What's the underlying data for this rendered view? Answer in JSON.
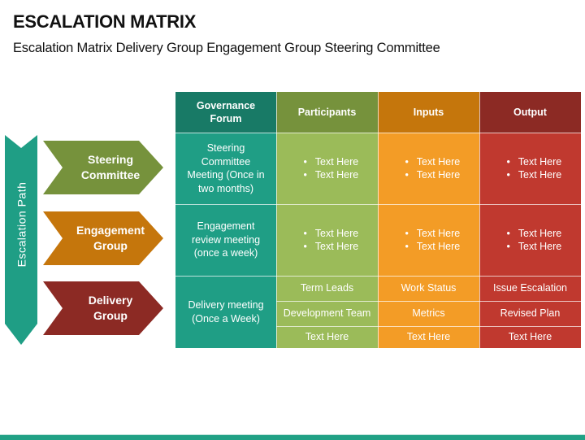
{
  "title": "ESCALATION MATRIX",
  "subtitle": "Escalation Matrix Delivery Group Engagement Group Steering Committee",
  "colors": {
    "teal": "#1f9e85",
    "teal_dark": "#187a66",
    "green": "#9bbb59",
    "green_dark": "#76923c",
    "orange": "#f39c26",
    "orange_dark": "#c5760c",
    "red": "#c0392f",
    "red_dark": "#8c2a24"
  },
  "escalation_path": {
    "label": "Escalation Path",
    "levels": [
      {
        "label_line1": "Steering",
        "label_line2": "Committee"
      },
      {
        "label_line1": "Engagement",
        "label_line2": "Group"
      },
      {
        "label_line1": "Delivery",
        "label_line2": "Group"
      }
    ]
  },
  "matrix": {
    "headers": {
      "governance_line1": "Governance",
      "governance_line2": "Forum",
      "participants": "Participants",
      "inputs": "Inputs",
      "output": "Output"
    },
    "rows": [
      {
        "forum": [
          "Steering",
          "Committee",
          "Meeting (Once in",
          "two months)"
        ],
        "participants": [
          "Text Here",
          "Text Here"
        ],
        "inputs": [
          "Text Here",
          "Text Here"
        ],
        "output": [
          "Text Here",
          "Text Here"
        ]
      },
      {
        "forum": [
          "Engagement",
          "review meeting",
          "(once a week)"
        ],
        "participants": [
          "Text Here",
          "Text Here"
        ],
        "inputs": [
          "Text Here",
          "Text Here"
        ],
        "output": [
          "Text Here",
          "Text Here"
        ]
      },
      {
        "forum": [
          "Delivery meeting",
          "(Once a Week)"
        ],
        "participants": [
          "Term Leads",
          "Development Team",
          "Text Here"
        ],
        "inputs": [
          "Work Status",
          "Metrics",
          "Text Here"
        ],
        "output": [
          "Issue Escalation",
          "Revised Plan",
          "Text Here"
        ]
      }
    ],
    "bullet": "•"
  }
}
